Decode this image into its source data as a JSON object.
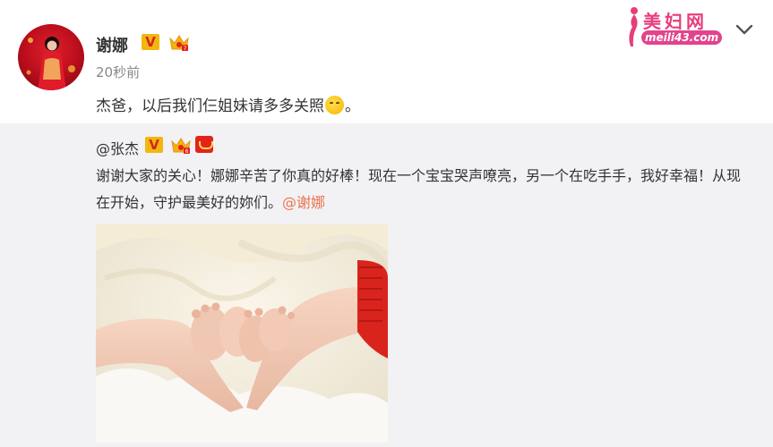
{
  "post": {
    "author": "谢娜",
    "verified_badge": "V",
    "time": "20秒前",
    "text_before_emoji": "杰爸，以后我们仨姐妹请多多关照",
    "text_after_emoji": "。",
    "emoji": "hug-emoji"
  },
  "repost": {
    "author": "@张杰",
    "verified_badge": "V",
    "text": "谢谢大家的关心！娜娜辛苦了你真的好棒！现在一个宝宝哭声嘹亮，另一个在吃手手，我好幸福！从现在开始，守护最美好的妳们。",
    "mention": "@谢娜"
  },
  "watermark": {
    "title": "美妇网",
    "url": "meili43.com"
  },
  "colors": {
    "vip_yellow": "#f2b70f",
    "mention_orange": "#eb7350",
    "repost_bg": "#f2f2f5",
    "watermark_pink": "#e83d7d"
  }
}
